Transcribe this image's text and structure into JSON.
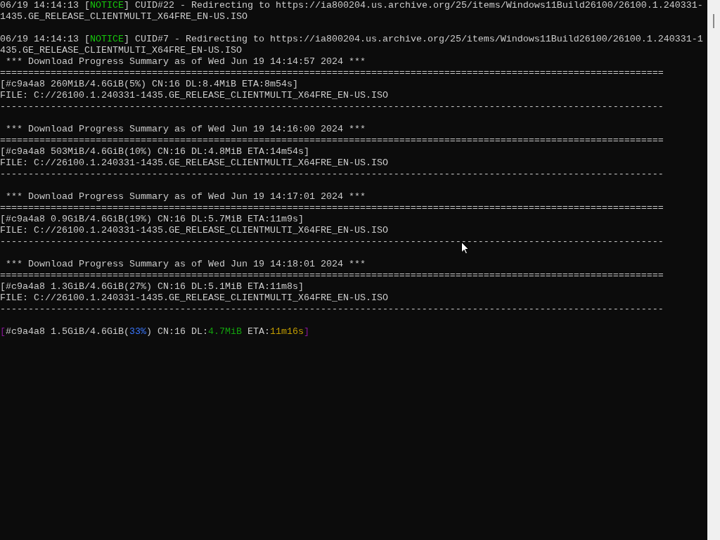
{
  "log": [
    {
      "kind": "colored",
      "segments": [
        {
          "text": "06/19 14:14:13 [",
          "color": "#cccccc"
        },
        {
          "text": "NOTICE",
          "color": "#16c60c"
        },
        {
          "text": "] CUID#22 - Redirecting to https://ia800204.us.archive.org/25/items/Windows11Build26100/26100.1.240331-",
          "color": "#cccccc"
        }
      ]
    },
    {
      "kind": "colored",
      "segments": [
        {
          "text": "1435.GE_RELEASE_CLIENTMULTI_X64FRE_EN-US.ISO",
          "color": "#cccccc"
        }
      ]
    },
    {
      "kind": "blank"
    },
    {
      "kind": "colored",
      "segments": [
        {
          "text": "06/19 14:14:13 [",
          "color": "#cccccc"
        },
        {
          "text": "NOTICE",
          "color": "#16c60c"
        },
        {
          "text": "] CUID#7 - Redirecting to https://ia800204.us.archive.org/25/items/Windows11Build26100/26100.1.240331-1",
          "color": "#cccccc"
        }
      ]
    },
    {
      "kind": "colored",
      "segments": [
        {
          "text": "435.GE_RELEASE_CLIENTMULTI_X64FRE_EN-US.ISO",
          "color": "#cccccc"
        }
      ]
    },
    {
      "kind": "summary",
      "header": " *** Download Progress Summary as of Wed Jun 19 14:14:57 2024 ***",
      "rule_top": "======================================================================================================================",
      "progress": "[#c9a4a8 260MiB/4.6GiB(5%) CN:16 DL:8.4MiB ETA:8m54s]",
      "file": "FILE: C://26100.1.240331-1435.GE_RELEASE_CLIENTMULTI_X64FRE_EN-US.ISO",
      "rule_bottom": "----------------------------------------------------------------------------------------------------------------------"
    },
    {
      "kind": "blank"
    },
    {
      "kind": "summary",
      "header": " *** Download Progress Summary as of Wed Jun 19 14:16:00 2024 ***",
      "rule_top": "======================================================================================================================",
      "progress": "[#c9a4a8 503MiB/4.6GiB(10%) CN:16 DL:4.8MiB ETA:14m54s]",
      "file": "FILE: C://26100.1.240331-1435.GE_RELEASE_CLIENTMULTI_X64FRE_EN-US.ISO",
      "rule_bottom": "----------------------------------------------------------------------------------------------------------------------"
    },
    {
      "kind": "blank"
    },
    {
      "kind": "summary",
      "header": " *** Download Progress Summary as of Wed Jun 19 14:17:01 2024 ***",
      "rule_top": "======================================================================================================================",
      "progress": "[#c9a4a8 0.9GiB/4.6GiB(19%) CN:16 DL:5.7MiB ETA:11m9s]",
      "file": "FILE: C://26100.1.240331-1435.GE_RELEASE_CLIENTMULTI_X64FRE_EN-US.ISO",
      "rule_bottom": "----------------------------------------------------------------------------------------------------------------------"
    },
    {
      "kind": "blank"
    },
    {
      "kind": "summary",
      "header": " *** Download Progress Summary as of Wed Jun 19 14:18:01 2024 ***",
      "rule_top": "======================================================================================================================",
      "progress": "[#c9a4a8 1.3GiB/4.6GiB(27%) CN:16 DL:5.1MiB ETA:11m8s]",
      "file": "FILE: C://26100.1.240331-1435.GE_RELEASE_CLIENTMULTI_X64FRE_EN-US.ISO",
      "rule_bottom": "----------------------------------------------------------------------------------------------------------------------"
    },
    {
      "kind": "blank"
    },
    {
      "kind": "colored",
      "segments": [
        {
          "text": "[",
          "color": "#881798"
        },
        {
          "text": "#c9a4a8 1.5GiB/4.6GiB(",
          "color": "#cccccc"
        },
        {
          "text": "33%",
          "color": "#3b78ff"
        },
        {
          "text": ") CN:16 DL:",
          "color": "#cccccc"
        },
        {
          "text": "4.7MiB",
          "color": "#13a10e"
        },
        {
          "text": " ETA:",
          "color": "#cccccc"
        },
        {
          "text": "11m16s",
          "color": "#c19c00"
        },
        {
          "text": "]",
          "color": "#881798"
        }
      ]
    }
  ]
}
